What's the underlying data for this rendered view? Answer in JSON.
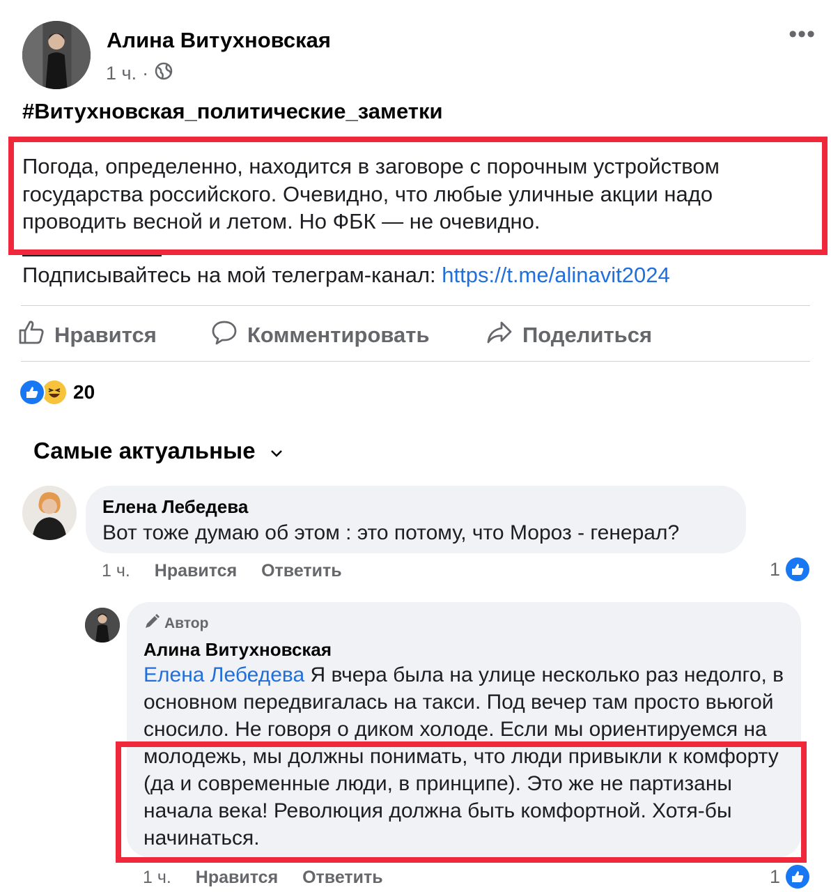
{
  "post": {
    "author": "Алина Витухновская",
    "time": "1 ч.",
    "more": "•••",
    "hashtag": "#Витухновская_политические_заметки",
    "text": "Погода, определенно, находится в заговоре с порочным устройством государства российского. Очевидно, что любые уличные акции надо проводить весной и летом. Но ФБК — не очевидно.",
    "subscribe_text": "Подписывайтесь на мой телеграм-канал: ",
    "subscribe_link": "https://t.me/alinavit2024"
  },
  "actions": {
    "like": "Нравится",
    "comment": "Комментировать",
    "share": "Поделиться"
  },
  "reactions": {
    "icons": [
      "like-icon",
      "haha-icon"
    ],
    "count": "20"
  },
  "sort": {
    "label": "Самые актуальные"
  },
  "comments": [
    {
      "author": "Елена Лебедева",
      "text": "Вот тоже думаю об этом : это потому, что Мороз - генерал?",
      "time": "1 ч.",
      "like": "Нравится",
      "reply": "Ответить",
      "likes": "1"
    }
  ],
  "reply": {
    "badge": "Автор",
    "author": "Алина Витухновская",
    "mention": "Елена Лебедева",
    "text": " Я вчера была на улице несколько раз недолго, в основном передвигалась на такси. Под вечер там просто вьюгой сносило. Не говоря о диком холоде. Если мы ориентируемся на молодежь, мы должны понимать, что люди привыкли к комфорту (да и современные люди, в принципе). Это же не партизаны начала века! Революция должна быть комфортной. Хотя-бы начинаться.",
    "time": "1 ч.",
    "like": "Нравится",
    "reply": "Ответить",
    "likes": "1"
  },
  "colors": {
    "highlight": "#f0283c",
    "link": "#216fdb",
    "like_blue": "#1877f2",
    "muted": "#65676b",
    "bubble": "#f0f2f5"
  }
}
